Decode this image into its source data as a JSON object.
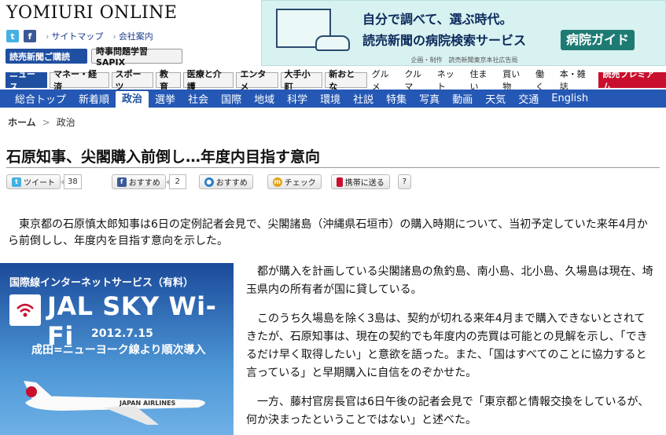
{
  "header": {
    "logo": "YOMIURI ONLINE",
    "links": [
      "サイトマップ",
      "会社案内"
    ],
    "buttons": [
      "読売新聞ご購読",
      "時事問題学習 SAPIX"
    ]
  },
  "banner": {
    "line1": "自分で調べて、選ぶ時代。",
    "line2": "読売新聞の病院検索サービス",
    "badge": "病院ガイド",
    "credit": "企画・制作　読売新聞東京本社広告局"
  },
  "nav_primary": [
    "ニュース",
    "マネー・経済",
    "スポーツ",
    "教育",
    "医療と介護",
    "エンタメ",
    "大手小町",
    "新おとな",
    "グルメ",
    "クルマ",
    "ネット",
    "住まい",
    "買い物",
    "働く",
    "本・雑誌",
    "読売プレミアム"
  ],
  "nav_secondary": [
    "総合トップ",
    "新着順",
    "政治",
    "選挙",
    "社会",
    "国際",
    "地域",
    "科学",
    "環境",
    "社説",
    "特集",
    "写真",
    "動画",
    "天気",
    "交通",
    "English"
  ],
  "breadcrumb": {
    "home": "ホーム",
    "separator": ">",
    "current": "政治"
  },
  "article": {
    "title": "石原知事、尖閣購入前倒し…年度内目指す意向",
    "share": {
      "tweet": "ツイート",
      "tweet_count": "38",
      "fb": "おすすめ",
      "fb_count": "2",
      "mixi": "おすすめ",
      "check": "チェック",
      "mobile": "携帯に送る",
      "help": "?"
    },
    "paragraphs": [
      "東京都の石原慎太郎知事は6日の定例記者会見で、尖閣諸島（沖縄県石垣市）の購入時期について、当初予定していた来年4月から前倒しし、年度内を目指す意向を示した。",
      "都が購入を計画している尖閣諸島の魚釣島、南小島、北小島、久場島は現在、埼玉県内の所有者が国に貸している。",
      "このうち久場島を除く3島は、契約が切れる来年4月まで購入できないとされてきたが、石原知事は、現在の契約でも年度内の売買は可能との見解を示し、「できるだけ早く取得したい」と意欲を語った。また、「国はすべてのことに協力すると言っている」と早期購入に自信をのぞかせた。",
      "一方、藤村官房長官は6日午後の記者会見で「東京都と情報交換をしているが、何か決まったということではない」と述べた。"
    ]
  },
  "ad": {
    "line1": "国際線インターネットサービス（有料）",
    "name": "JAL SKY Wi-Fi",
    "logo_text": "JAL SKY Wi-Fi",
    "date": "2012.7.15",
    "route": "成田=ニューヨーク線より順次導入",
    "livery": "JAPAN AIRLINES"
  },
  "colors": {
    "nav_blue": "#2558b4",
    "premium_red": "#c8102e",
    "banner_teal": "#1e7b74"
  }
}
